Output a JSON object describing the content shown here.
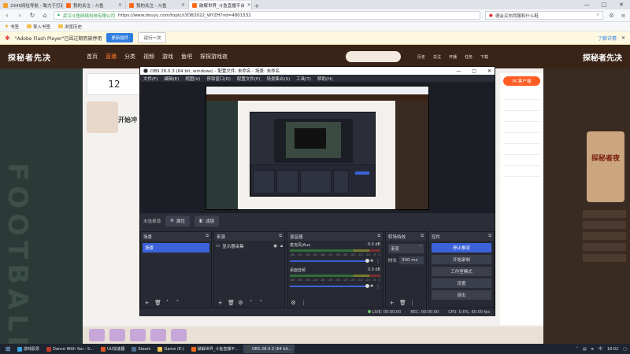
{
  "browser": {
    "tabs": [
      {
        "title": "2345网址导航 - 致力于打造百年品牌",
        "color": "#f0a030"
      },
      {
        "title": "我的关注 - 斗鱼",
        "color": "#ff6a1a"
      },
      {
        "title": "我的关注 - 斗鱼",
        "color": "#ff6a1a"
      },
      {
        "title": "破解世界_斗鱼直播平台",
        "color": "#ff6a1a",
        "active": true
      }
    ],
    "new_tab": "+",
    "window_buttons": [
      "—",
      "□",
      "✕"
    ],
    "nav": {
      "back": "‹",
      "forward": "›",
      "reload": "↻",
      "home": "⌂"
    },
    "site_name": "武汉斗鱼网络科技有限公司",
    "url": "https://www.douyu.com/topic/LYDB2022_WYZH?rid=4801532",
    "search_text": "德会买你西服和什么鞋",
    "bookmarks": [
      {
        "label": "书签",
        "icon": "star"
      },
      {
        "label": "导入书签",
        "icon": "folder"
      },
      {
        "label": "浏览历史",
        "icon": "folder"
      }
    ],
    "infobar": {
      "message": "\"Adobe Flash Player\"已因过期而被停用",
      "update_label": "更新插件",
      "run_once_label": "运行一次",
      "learn_more": "了解详情",
      "close": "✕"
    }
  },
  "douyu": {
    "logo_text": "探秘者先决",
    "nav": [
      "首页",
      "直播",
      "分类",
      "视频",
      "游戏",
      "鱼吧",
      "探探游戏夜"
    ],
    "active_nav": 1,
    "header_icons": [
      "历史",
      "关注",
      "开播",
      "任务",
      "下载"
    ],
    "right_logo_text": "探秘者先决",
    "watermark": "FOOTBALL",
    "left_number": "12",
    "start_text": "开始冲",
    "pc_button": "PC客户端",
    "promo_text": "探秘者夜"
  },
  "obs": {
    "title": "OBS 28.0.3 (64 bit, windows) - 配置文件: 未命名 - 场景: 未命名",
    "menu": [
      "文件(F)",
      "编辑(E)",
      "视图(V)",
      "停靠窗口(D)",
      "配置文件(P)",
      "场景集合(S)",
      "工具(T)",
      "帮助(H)"
    ],
    "source_bar": {
      "no_source": "未选择源",
      "properties": "属性",
      "filters": "滤镜"
    },
    "docks": {
      "scenes": {
        "title": "场景",
        "items": [
          "场景"
        ]
      },
      "sources": {
        "title": "来源",
        "items": [
          "显示器采集"
        ]
      },
      "mixer": {
        "title": "混音器",
        "channels": [
          {
            "name": "麦克风/Aux",
            "db": "0.0 dB"
          },
          {
            "name": "桌面音频",
            "db": "0.0 dB"
          }
        ],
        "ticks": [
          "-60",
          "-55",
          "-50",
          "-45",
          "-40",
          "-35",
          "-30",
          "-25",
          "-20",
          "-15",
          "-10",
          "-5",
          "0"
        ]
      },
      "transitions": {
        "title": "转场特效",
        "selected": "渐变",
        "duration_label": "时长",
        "duration": "300 ms"
      },
      "controls": {
        "title": "控件",
        "buttons": [
          "停止推流",
          "开始录制",
          "工作室模式",
          "设置",
          "退出"
        ]
      }
    },
    "status": {
      "live": "LIVE: 00:00:00",
      "rec": "REC: 00:00:00",
      "cpu": "CPU: 0.6%, 60.00 fps"
    }
  },
  "taskbar": {
    "items": [
      {
        "label": "游戏股票",
        "color": "#3aa3e3"
      },
      {
        "label": "Dance With You - S...",
        "color": "#c0392b"
      },
      {
        "label": "UU加速器",
        "color": "#e0562a"
      },
      {
        "label": "Steam",
        "color": "#1b2838"
      },
      {
        "label": "Game (E:)",
        "color": "#f2c14e"
      },
      {
        "label": "破解世界_斗鱼直播平...",
        "color": "#ff6a1a"
      },
      {
        "label": "OBS 28.0.3 (64 bit...",
        "color": "#444",
        "active": true
      }
    ],
    "tray": {
      "lang": "中",
      "time": "19:02"
    }
  }
}
